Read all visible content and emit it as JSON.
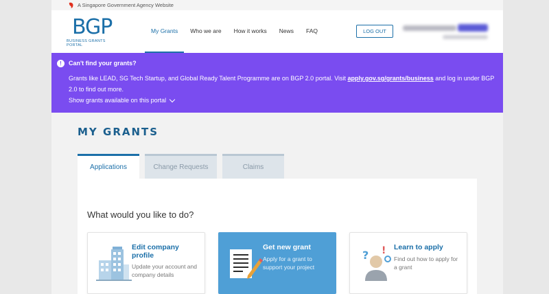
{
  "gov_bar": {
    "text": "A Singapore Government Agency Website"
  },
  "logo": {
    "text": "BGP",
    "subtitle": "BUSINESS GRANTS PORTAL"
  },
  "nav": {
    "items": [
      "My Grants",
      "Who we are",
      "How it works",
      "News",
      "FAQ"
    ],
    "active": "My Grants"
  },
  "header": {
    "logout_label": "LOG OUT"
  },
  "banner": {
    "title": "Can't find your grants?",
    "body_prefix": "Grants like LEAD, SG Tech Startup, and Global Ready Talent Programme are on BGP 2.0 portal. Visit ",
    "link_text": "apply.gov.sg/grants/business",
    "body_suffix": " and log in under BGP 2.0 to find out more.",
    "toggle_label": "Show grants available on this portal",
    "color": "#7a4cf0"
  },
  "main": {
    "title": "MY GRANTS",
    "tabs": [
      "Applications",
      "Change Requests",
      "Claims"
    ],
    "active_tab": "Applications",
    "prompt": "What would you like to do?",
    "cards": [
      {
        "title": "Edit company profile",
        "desc": "Update your account and company details",
        "icon": "building-icon"
      },
      {
        "title": "Get new grant",
        "desc": "Apply for a grant to support your project",
        "icon": "document-pen-icon"
      },
      {
        "title": "Learn to apply",
        "desc": "Find out how to apply for a grant",
        "icon": "person-question-icon"
      }
    ]
  },
  "colors": {
    "accent": "#1b6fa8",
    "card_primary": "#4f9fd6"
  }
}
